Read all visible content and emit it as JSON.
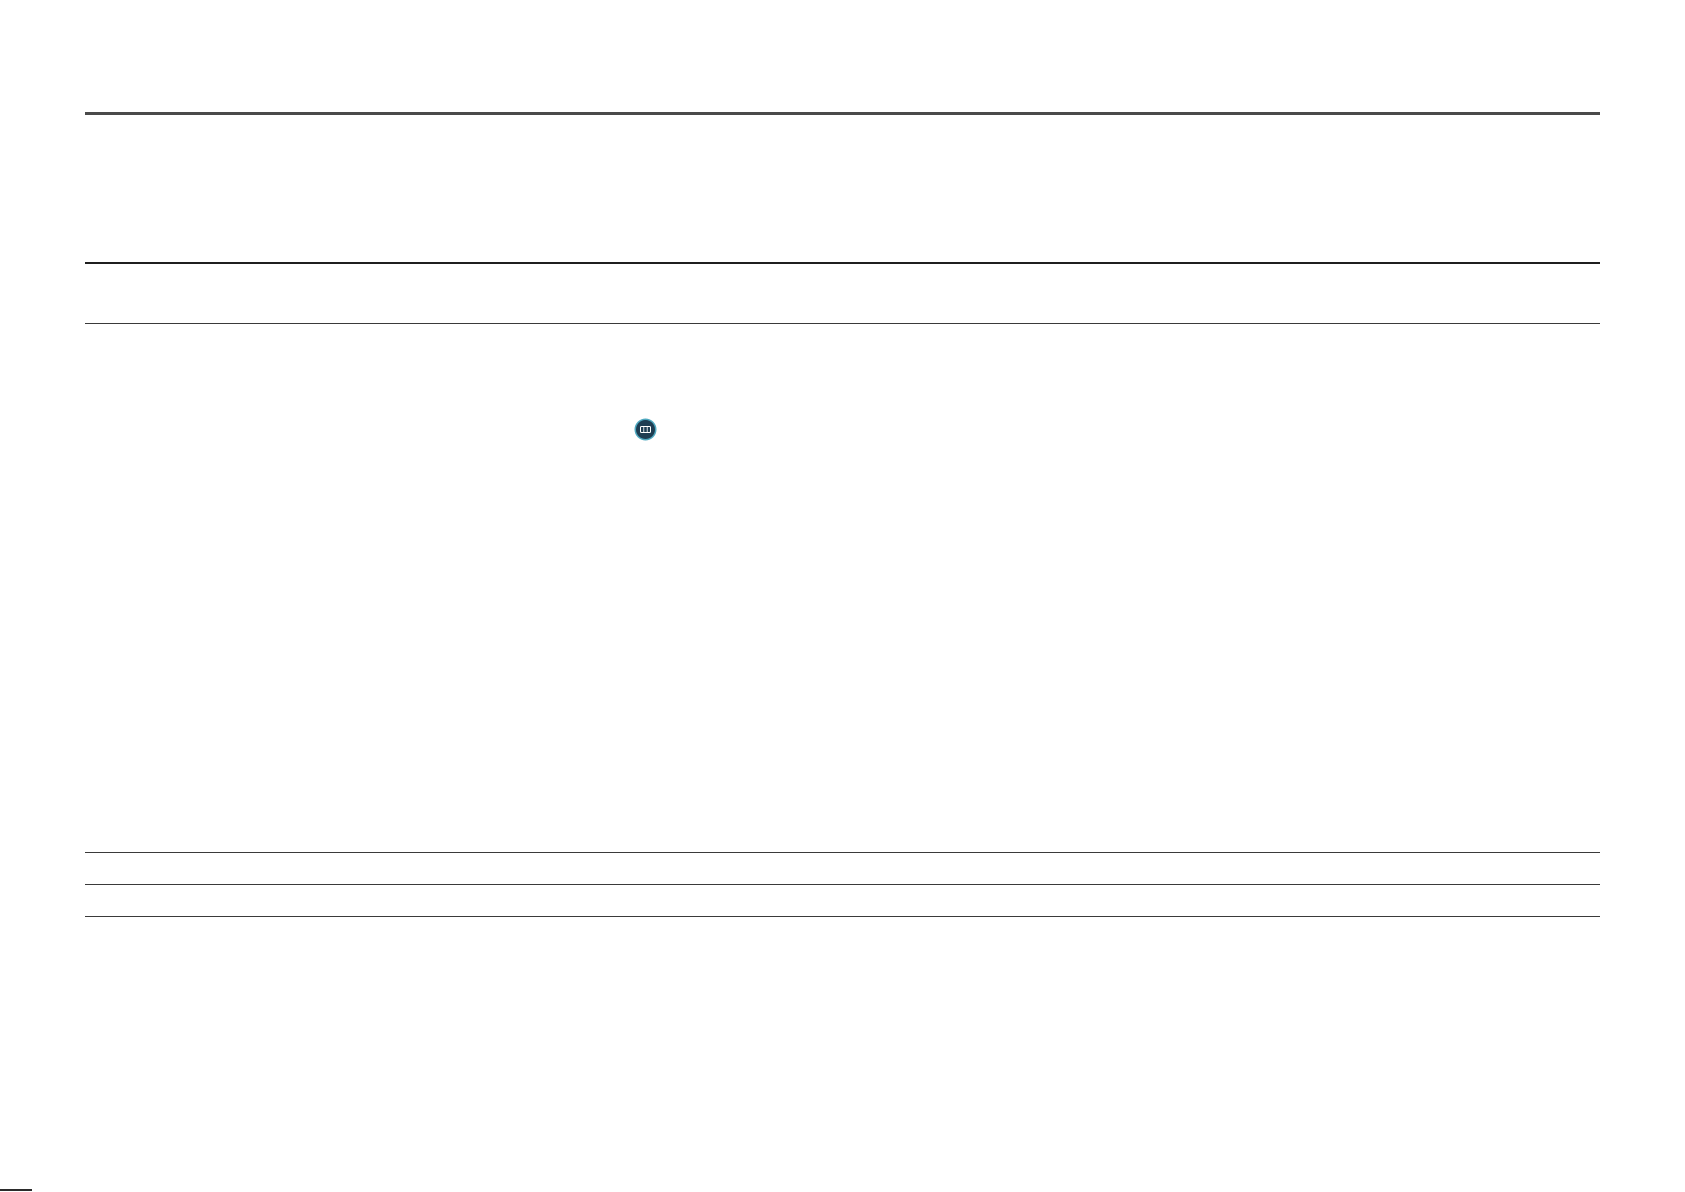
{
  "icons": {
    "remote_button": "menu-button-icon"
  },
  "colors": {
    "rule": "#2b2b2b",
    "icon_fill": "#1e3d52",
    "icon_ring": "#4fa8bf"
  }
}
